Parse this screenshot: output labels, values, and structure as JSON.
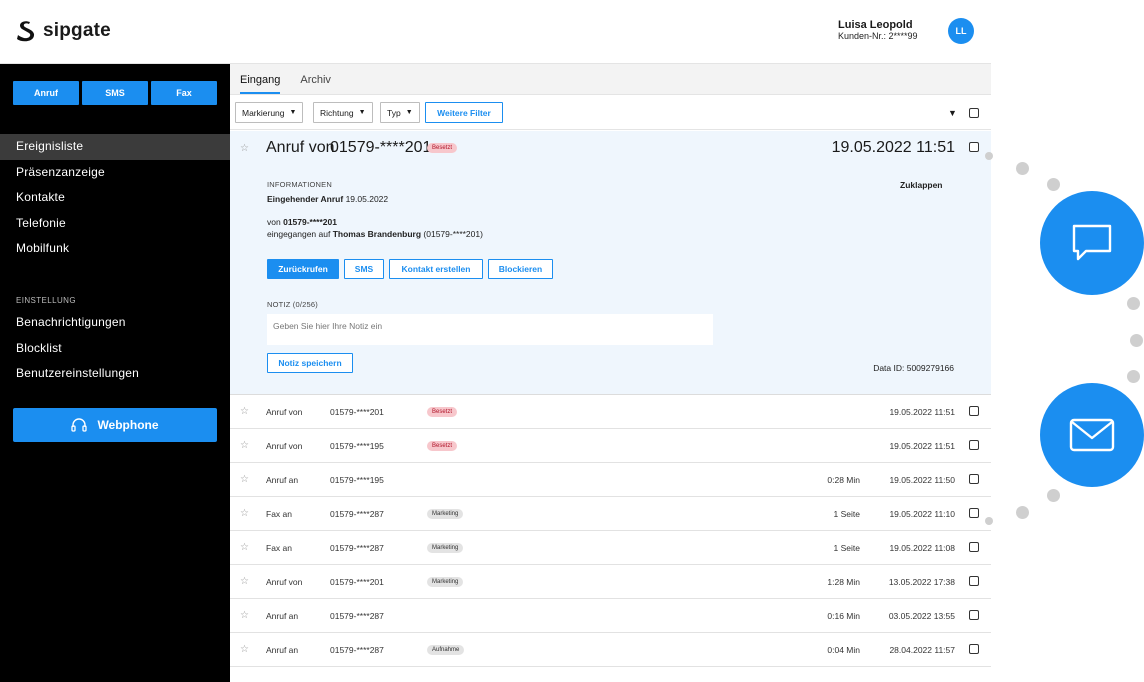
{
  "brand": {
    "name": "sipgate",
    "accent": "#1b8ef0"
  },
  "user": {
    "name": "Luisa Leopold",
    "customer_id": "Kunden-Nr.: 2****99",
    "initials": "LL"
  },
  "sidebar": {
    "quick_actions": [
      "Anruf",
      "SMS",
      "Fax"
    ],
    "nav": [
      "Ereignisliste",
      "Präsenzanzeige",
      "Kontakte",
      "Telefonie",
      "Mobilfunk"
    ],
    "section_title": "EINSTELLUNG",
    "settings": [
      "Benachrichtigungen",
      "Blocklist",
      "Benutzereinstellungen"
    ],
    "webphone_label": "Webphone"
  },
  "tabs": [
    "Eingang",
    "Archiv"
  ],
  "filters": {
    "markierung": "Markierung",
    "richtung": "Richtung",
    "typ": "Typ",
    "more": "Weitere Filter"
  },
  "expanded": {
    "type": "Anruf von",
    "number": "01579-****201",
    "badge": "Besetzt",
    "date": "19.05.2022 11:51",
    "info_title": "INFORMATIONEN",
    "collapse": "Zuklappen",
    "call_type": "Eingehender Anruf",
    "call_date": "19.05.2022",
    "from_prefix": "von",
    "from_number": "01579-****201",
    "received_prefix": "eingegangen auf",
    "received_name": "Thomas Brandenburg",
    "received_number": "(01579-****201)",
    "actions": [
      "Zurückrufen",
      "SMS",
      "Kontakt erstellen",
      "Blockieren"
    ],
    "note_label": "NOTIZ (0/256)",
    "note_placeholder": "Geben Sie hier Ihre Notiz ein",
    "save_note": "Notiz speichern",
    "data_id": "Data ID: 5009279166"
  },
  "rows": [
    {
      "type": "Anruf von",
      "number": "01579-****201",
      "badge": "Besetzt",
      "badge_kind": "busy",
      "extra": "",
      "date": "19.05.2022 11:51"
    },
    {
      "type": "Anruf von",
      "number": "01579-****195",
      "badge": "Besetzt",
      "badge_kind": "busy",
      "extra": "",
      "date": "19.05.2022 11:51"
    },
    {
      "type": "Anruf an",
      "number": "01579-****195",
      "badge": "",
      "badge_kind": "",
      "extra": "0:28 Min",
      "date": "19.05.2022 11:50"
    },
    {
      "type": "Fax an",
      "number": "01579-****287",
      "badge": "Marketing",
      "badge_kind": "tag",
      "extra": "1 Seite",
      "date": "19.05.2022 11:10"
    },
    {
      "type": "Fax an",
      "number": "01579-****287",
      "badge": "Marketing",
      "badge_kind": "tag",
      "extra": "1 Seite",
      "date": "19.05.2022 11:08"
    },
    {
      "type": "Anruf von",
      "number": "01579-****201",
      "badge": "Marketing",
      "badge_kind": "tag",
      "extra": "1:28 Min",
      "date": "13.05.2022 17:38"
    },
    {
      "type": "Anruf an",
      "number": "01579-****287",
      "badge": "",
      "badge_kind": "",
      "extra": "0:16 Min",
      "date": "03.05.2022 13:55"
    },
    {
      "type": "Anruf an",
      "number": "01579-****287",
      "badge": "Aufnahme",
      "badge_kind": "tag",
      "extra": "0:04 Min",
      "date": "28.04.2022 11:57"
    }
  ],
  "decor": {
    "chat_icon": "chat-bubble-icon",
    "mail_icon": "envelope-icon"
  }
}
